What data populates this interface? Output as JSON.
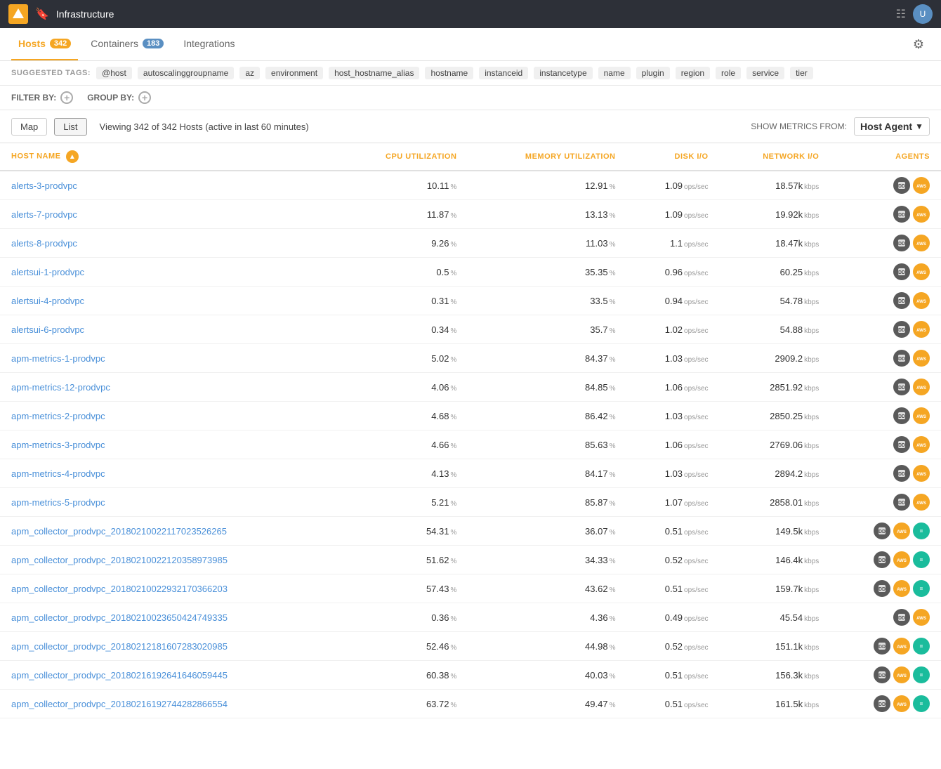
{
  "topNav": {
    "appName": "Infrastructure",
    "gridLabel": "grid",
    "userInitial": "U"
  },
  "tabs": [
    {
      "label": "Hosts",
      "badge": "342",
      "active": true,
      "type": "hosts"
    },
    {
      "label": "Containers",
      "badge": "183",
      "active": false,
      "type": "containers"
    },
    {
      "label": "Integrations",
      "badge": null,
      "active": false,
      "type": "integrations"
    }
  ],
  "suggestedTags": {
    "label": "SUGGESTED TAGS:",
    "tags": [
      "@host",
      "autoscalinggroupname",
      "az",
      "environment",
      "host_hostname_alias",
      "hostname",
      "instanceid",
      "instancetype",
      "name",
      "plugin",
      "region",
      "role",
      "service",
      "tier"
    ]
  },
  "filterBar": {
    "filterLabel": "FILTER BY:",
    "groupLabel": "GROUP BY:"
  },
  "toolbar": {
    "mapLabel": "Map",
    "listLabel": "List",
    "viewingText": "Viewing 342 of 342 Hosts (active in last 60 minutes)",
    "showMetricsLabel": "SHOW METRICS FROM:",
    "metricsSource": "Host Agent"
  },
  "table": {
    "columns": {
      "hostName": "HOST NAME",
      "cpuUtilization": "CPU UTILIZATION",
      "memoryUtilization": "MEMORY UTILIZATION",
      "diskIO": "DISK I/O",
      "networkIO": "NETWORK I/O",
      "agents": "AGENTS"
    },
    "rows": [
      {
        "host": "alerts-3-prodvpc",
        "cpu": "10.11",
        "cpuUnit": "%",
        "mem": "12.91",
        "memUnit": "%",
        "disk": "1.09",
        "diskUnit": "ops/sec",
        "net": "18.57k",
        "netUnit": "kbps",
        "agents": [
          "dd",
          "aws"
        ]
      },
      {
        "host": "alerts-7-prodvpc",
        "cpu": "11.87",
        "cpuUnit": "%",
        "mem": "13.13",
        "memUnit": "%",
        "disk": "1.09",
        "diskUnit": "ops/sec",
        "net": "19.92k",
        "netUnit": "kbps",
        "agents": [
          "dd",
          "aws"
        ]
      },
      {
        "host": "alerts-8-prodvpc",
        "cpu": "9.26",
        "cpuUnit": "%",
        "mem": "11.03",
        "memUnit": "%",
        "disk": "1.1",
        "diskUnit": "ops/sec",
        "net": "18.47k",
        "netUnit": "kbps",
        "agents": [
          "dd",
          "aws"
        ]
      },
      {
        "host": "alertsui-1-prodvpc",
        "cpu": "0.5",
        "cpuUnit": "%",
        "mem": "35.35",
        "memUnit": "%",
        "disk": "0.96",
        "diskUnit": "ops/sec",
        "net": "60.25",
        "netUnit": "kbps",
        "agents": [
          "dd",
          "aws"
        ]
      },
      {
        "host": "alertsui-4-prodvpc",
        "cpu": "0.31",
        "cpuUnit": "%",
        "mem": "33.5",
        "memUnit": "%",
        "disk": "0.94",
        "diskUnit": "ops/sec",
        "net": "54.78",
        "netUnit": "kbps",
        "agents": [
          "dd",
          "aws"
        ]
      },
      {
        "host": "alertsui-6-prodvpc",
        "cpu": "0.34",
        "cpuUnit": "%",
        "mem": "35.7",
        "memUnit": "%",
        "disk": "1.02",
        "diskUnit": "ops/sec",
        "net": "54.88",
        "netUnit": "kbps",
        "agents": [
          "dd",
          "aws"
        ]
      },
      {
        "host": "apm-metrics-1-prodvpc",
        "cpu": "5.02",
        "cpuUnit": "%",
        "mem": "84.37",
        "memUnit": "%",
        "disk": "1.03",
        "diskUnit": "ops/sec",
        "net": "2909.2",
        "netUnit": "kbps",
        "agents": [
          "dd",
          "aws"
        ]
      },
      {
        "host": "apm-metrics-12-prodvpc",
        "cpu": "4.06",
        "cpuUnit": "%",
        "mem": "84.85",
        "memUnit": "%",
        "disk": "1.06",
        "diskUnit": "ops/sec",
        "net": "2851.92",
        "netUnit": "kbps",
        "agents": [
          "dd",
          "aws"
        ]
      },
      {
        "host": "apm-metrics-2-prodvpc",
        "cpu": "4.68",
        "cpuUnit": "%",
        "mem": "86.42",
        "memUnit": "%",
        "disk": "1.03",
        "diskUnit": "ops/sec",
        "net": "2850.25",
        "netUnit": "kbps",
        "agents": [
          "dd",
          "aws"
        ]
      },
      {
        "host": "apm-metrics-3-prodvpc",
        "cpu": "4.66",
        "cpuUnit": "%",
        "mem": "85.63",
        "memUnit": "%",
        "disk": "1.06",
        "diskUnit": "ops/sec",
        "net": "2769.06",
        "netUnit": "kbps",
        "agents": [
          "dd",
          "aws"
        ]
      },
      {
        "host": "apm-metrics-4-prodvpc",
        "cpu": "4.13",
        "cpuUnit": "%",
        "mem": "84.17",
        "memUnit": "%",
        "disk": "1.03",
        "diskUnit": "ops/sec",
        "net": "2894.2",
        "netUnit": "kbps",
        "agents": [
          "dd",
          "aws"
        ]
      },
      {
        "host": "apm-metrics-5-prodvpc",
        "cpu": "5.21",
        "cpuUnit": "%",
        "mem": "85.87",
        "memUnit": "%",
        "disk": "1.07",
        "diskUnit": "ops/sec",
        "net": "2858.01",
        "netUnit": "kbps",
        "agents": [
          "dd",
          "aws"
        ]
      },
      {
        "host": "apm_collector_prodvpc_20180210022117023526265",
        "cpu": "54.31",
        "cpuUnit": "%",
        "mem": "36.07",
        "memUnit": "%",
        "disk": "0.51",
        "diskUnit": "ops/sec",
        "net": "149.5k",
        "netUnit": "kbps",
        "agents": [
          "dd",
          "aws",
          "proc"
        ]
      },
      {
        "host": "apm_collector_prodvpc_20180210022120358973985",
        "cpu": "51.62",
        "cpuUnit": "%",
        "mem": "34.33",
        "memUnit": "%",
        "disk": "0.52",
        "diskUnit": "ops/sec",
        "net": "146.4k",
        "netUnit": "kbps",
        "agents": [
          "dd",
          "aws",
          "proc"
        ]
      },
      {
        "host": "apm_collector_prodvpc_20180210022932170366203",
        "cpu": "57.43",
        "cpuUnit": "%",
        "mem": "43.62",
        "memUnit": "%",
        "disk": "0.51",
        "diskUnit": "ops/sec",
        "net": "159.7k",
        "netUnit": "kbps",
        "agents": [
          "dd",
          "aws",
          "proc"
        ]
      },
      {
        "host": "apm_collector_prodvpc_20180210023650424749335",
        "cpu": "0.36",
        "cpuUnit": "%",
        "mem": "4.36",
        "memUnit": "%",
        "disk": "0.49",
        "diskUnit": "ops/sec",
        "net": "45.54",
        "netUnit": "kbps",
        "agents": [
          "dd",
          "aws"
        ]
      },
      {
        "host": "apm_collector_prodvpc_20180212181607283020985",
        "cpu": "52.46",
        "cpuUnit": "%",
        "mem": "44.98",
        "memUnit": "%",
        "disk": "0.52",
        "diskUnit": "ops/sec",
        "net": "151.1k",
        "netUnit": "kbps",
        "agents": [
          "dd",
          "aws",
          "proc"
        ]
      },
      {
        "host": "apm_collector_prodvpc_20180216192641646059445",
        "cpu": "60.38",
        "cpuUnit": "%",
        "mem": "40.03",
        "memUnit": "%",
        "disk": "0.51",
        "diskUnit": "ops/sec",
        "net": "156.3k",
        "netUnit": "kbps",
        "agents": [
          "dd",
          "aws",
          "proc"
        ]
      },
      {
        "host": "apm_collector_prodvpc_20180216192744282866554",
        "cpu": "63.72",
        "cpuUnit": "%",
        "mem": "49.47",
        "memUnit": "%",
        "disk": "0.51",
        "diskUnit": "ops/sec",
        "net": "161.5k",
        "netUnit": "kbps",
        "agents": [
          "dd",
          "aws",
          "proc"
        ]
      }
    ]
  }
}
